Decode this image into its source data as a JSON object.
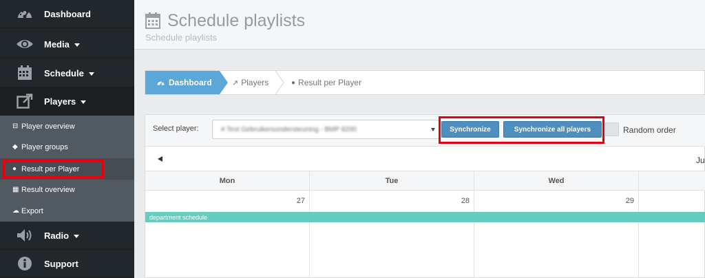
{
  "sidebar": {
    "items": [
      {
        "label": "Dashboard",
        "icon": "dashboard-icon",
        "has_caret": false
      },
      {
        "label": "Media",
        "icon": "eye-icon",
        "has_caret": true
      },
      {
        "label": "Schedule",
        "icon": "calendar-icon",
        "has_caret": true
      },
      {
        "label": "Players",
        "icon": "external-link-icon",
        "has_caret": true
      },
      {
        "label": "Radio",
        "icon": "volume-icon",
        "has_caret": true
      },
      {
        "label": "Support",
        "icon": "info-icon",
        "has_caret": false
      }
    ],
    "submenu": [
      {
        "label": "Player overview",
        "icon": "drive-icon"
      },
      {
        "label": "Player groups",
        "icon": "tags-icon"
      },
      {
        "label": "Result per Player",
        "icon": "globe-icon"
      },
      {
        "label": "Result overview",
        "icon": "table-icon"
      },
      {
        "label": "Export",
        "icon": "cloud-upload-icon"
      }
    ]
  },
  "header": {
    "title": "Schedule playlists",
    "subtitle": "Schedule playlists"
  },
  "breadcrumb": {
    "home": "Dashboard",
    "players": "Players",
    "current": "Result per Player"
  },
  "toolbar": {
    "select_label": "Select player:",
    "select_value": "# Test Gebruikersondersteuning - BMP 8200",
    "sync_label": "Synchronize",
    "sync_all_label": "Synchronize all players",
    "random_label": "Random order"
  },
  "calendar": {
    "month_partial": "Ju",
    "days": [
      {
        "name": "Mon",
        "num": "27"
      },
      {
        "name": "Tue",
        "num": "28"
      },
      {
        "name": "Wed",
        "num": "29"
      },
      {
        "name": "",
        "num": ""
      }
    ],
    "event": "department schedule"
  },
  "colors": {
    "accent": "#5ba7d8",
    "event": "#64cdbf",
    "highlight": "#e8000e",
    "sidebar": "#22272b"
  }
}
